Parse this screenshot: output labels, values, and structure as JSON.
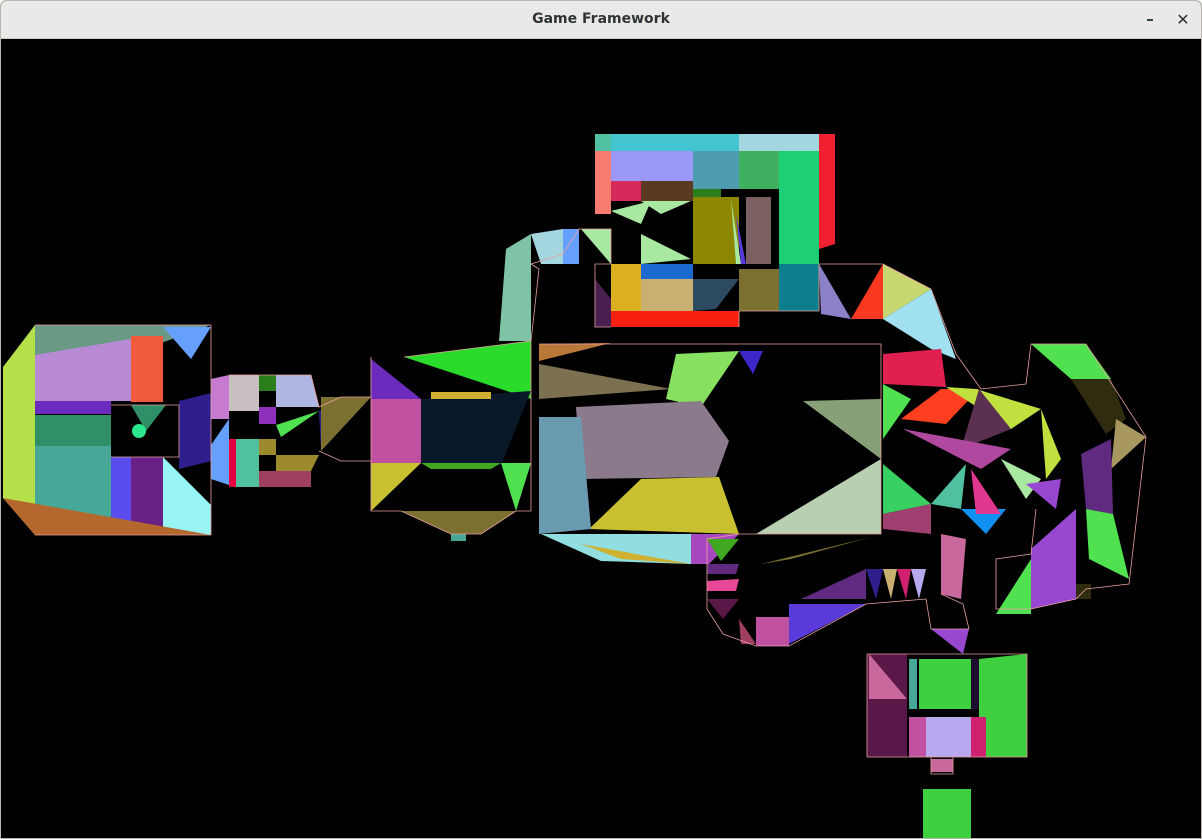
{
  "window": {
    "title": "Game Framework",
    "minimize_glyph": "–",
    "close_glyph": "✕"
  },
  "scene": {
    "background": "#000000",
    "outline_color": "#e8a0a0",
    "colors": [
      "#b6e04a",
      "#6a9a86",
      "#b88ad4",
      "#ef5b3c",
      "#66a0ff",
      "#6b2bbd",
      "#2f8f66",
      "#48a898",
      "#5b4cf0",
      "#6a2185",
      "#99f4f4",
      "#b5682e",
      "#c67bd0",
      "#2f1f8c",
      "#e20043",
      "#2c7d1c",
      "#b0b6e2",
      "#9c8a2c",
      "#7ec3a6",
      "#8e2fbd",
      "#44c3d0",
      "#a4d6e0",
      "#f87c70",
      "#9c98fa",
      "#4e9cb0",
      "#3fb060",
      "#1ecf76",
      "#f02030",
      "#d62a5a",
      "#5a3a20",
      "#8c8600",
      "#c8c0c0",
      "#7a6060",
      "#dab020",
      "#1c6ad0",
      "#c8b070",
      "#2c4a60",
      "#7c7030",
      "#0c7f8c",
      "#f82010",
      "#4a2050",
      "#a8e8a0",
      "#3ae0c8",
      "#8c80c8",
      "#f83820",
      "#c8d870",
      "#a0e0f0",
      "#ba7838",
      "#7c7050",
      "#88e060",
      "#3c28c8",
      "#8a7a8c",
      "#c8c030",
      "#6a9ab0",
      "#88a078",
      "#b8d0b0",
      "#90dee0",
      "#d0b030",
      "#a848c0",
      "#e06060",
      "#e02050",
      "#40c8a0",
      "#c0e040",
      "#302c10",
      "#a89860",
      "#ff4020",
      "#5c3050",
      "#b048a0",
      "#38d060",
      "#ffffff",
      "#a04070",
      "#1090f0",
      "#50c0a0",
      "#e03890",
      "#9848d0",
      "#50e050",
      "#40a820",
      "#602a80",
      "#e84898",
      "#5a1848",
      "#a04060",
      "#c050a0",
      "#5a3ad8",
      "#b8a8f0",
      "#d02070",
      "#c8689c",
      "#3fd03f",
      "#2bdb2b",
      "#1c0c30",
      "#081828"
    ]
  }
}
